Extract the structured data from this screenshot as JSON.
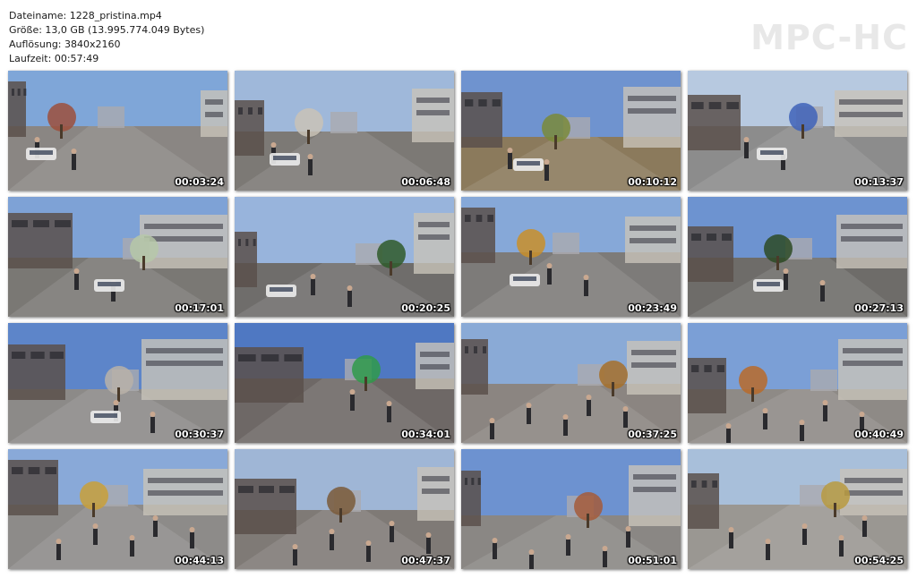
{
  "file_info": {
    "filename": "Dateiname: 1228_pristina.mp4",
    "size": "Größe: 13,0 GB (13.995.774.049 Bytes)",
    "resolution": "Auflösung: 3840x2160",
    "duration": "Laufzeit: 00:57:49"
  },
  "logo": "MPC-HC",
  "thumbnails": [
    {
      "time": "00:03:24",
      "sky": "#7fa6d8",
      "ground": "#8a8683",
      "accent": "#9c4f3c"
    },
    {
      "time": "00:06:48",
      "sky": "#9fb8da",
      "ground": "#7c7975",
      "accent": "#c9c2b6"
    },
    {
      "time": "00:10:12",
      "sky": "#6f93cf",
      "ground": "#8b7a5c",
      "accent": "#7a8a3a"
    },
    {
      "time": "00:13:37",
      "sky": "#b7c9e0",
      "ground": "#8c8c8c",
      "accent": "#3f63b8"
    },
    {
      "time": "00:17:01",
      "sky": "#7ea2d6",
      "ground": "#7a7874",
      "accent": "#b6c8a8"
    },
    {
      "time": "00:20:25",
      "sky": "#98b4dc",
      "ground": "#6f6d6b",
      "accent": "#2f5a2a"
    },
    {
      "time": "00:23:49",
      "sky": "#86a8d8",
      "ground": "#7d7b79",
      "accent": "#c98f2a"
    },
    {
      "time": "00:27:13",
      "sky": "#6d93d0",
      "ground": "#6e6c69",
      "accent": "#2d4a25"
    },
    {
      "time": "00:30:37",
      "sky": "#5d85c9",
      "ground": "#8c8a88",
      "accent": "#b8b2a8"
    },
    {
      "time": "00:34:01",
      "sky": "#4f78c2",
      "ground": "#6e6866",
      "accent": "#2f9a4a"
    },
    {
      "time": "00:37:25",
      "sky": "#8aaad6",
      "ground": "#8b8581",
      "accent": "#a6702a"
    },
    {
      "time": "00:40:49",
      "sky": "#7b9fd6",
      "ground": "#8e8a86",
      "accent": "#b86a2a"
    },
    {
      "time": "00:44:13",
      "sky": "#89a9d8",
      "ground": "#8d8b89",
      "accent": "#c9a03a"
    },
    {
      "time": "00:47:37",
      "sky": "#9fb6d6",
      "ground": "#7f7a76",
      "accent": "#7a5a3a"
    },
    {
      "time": "00:51:01",
      "sky": "#6d92d0",
      "ground": "#8a8784",
      "accent": "#a55a3a"
    },
    {
      "time": "00:54:25",
      "sky": "#a8bfda",
      "ground": "#9a9792",
      "accent": "#b89a40"
    }
  ]
}
